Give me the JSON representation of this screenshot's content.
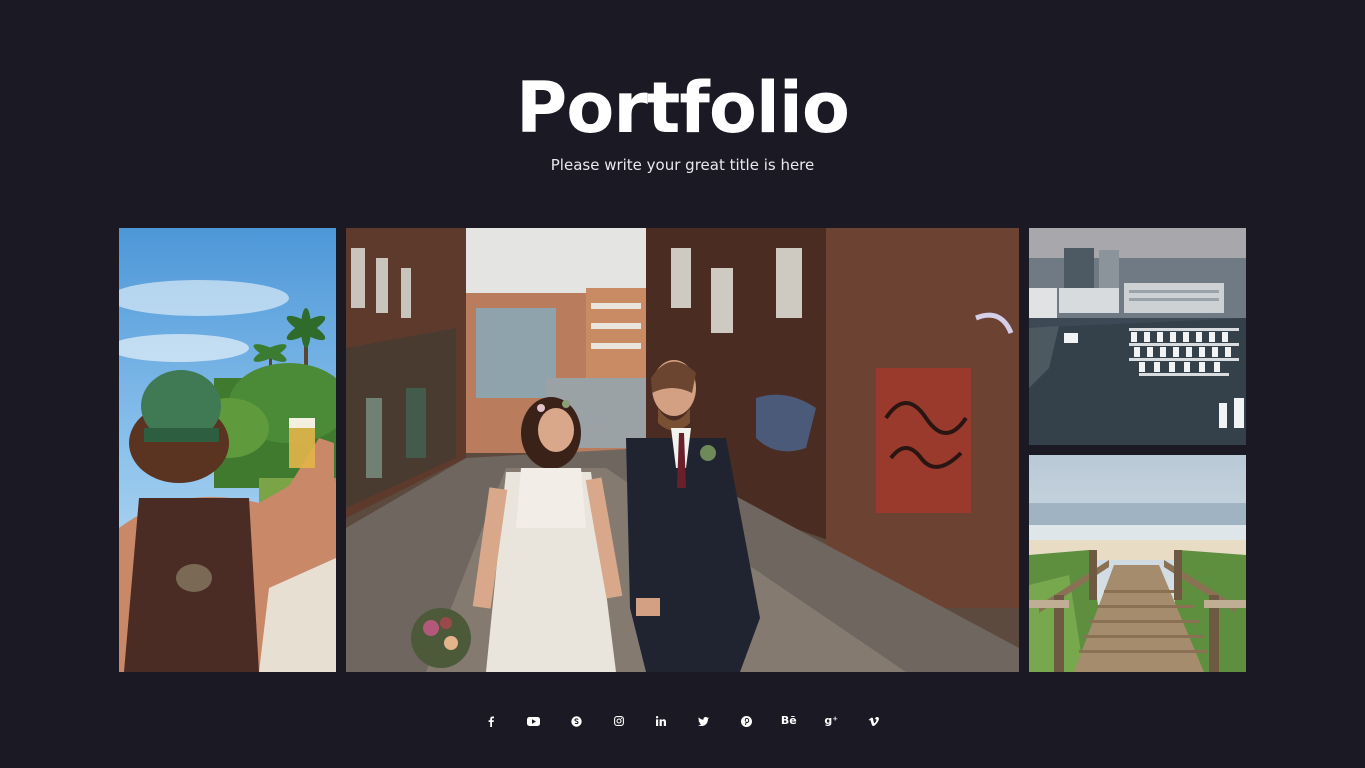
{
  "header": {
    "title": "Portfolio",
    "subtitle": "Please write your great title is here"
  },
  "gallery": {
    "images": [
      {
        "name": "man with cap and drink under palm trees"
      },
      {
        "name": "bride and groom walking in brick alley"
      },
      {
        "name": "aerial view of city marina with boats"
      },
      {
        "name": "wooden stairs leading to beach"
      }
    ]
  },
  "social": {
    "items": [
      {
        "icon": "facebook-icon"
      },
      {
        "icon": "youtube-icon"
      },
      {
        "icon": "skype-icon"
      },
      {
        "icon": "instagram-icon"
      },
      {
        "icon": "linkedin-icon"
      },
      {
        "icon": "twitter-icon"
      },
      {
        "icon": "pinterest-icon"
      },
      {
        "icon": "behance-icon",
        "text": "Bē"
      },
      {
        "icon": "google-plus-icon",
        "text": "g⁺"
      },
      {
        "icon": "vimeo-icon"
      }
    ]
  },
  "colors": {
    "background": "#1b1923",
    "text": "#ffffff"
  }
}
